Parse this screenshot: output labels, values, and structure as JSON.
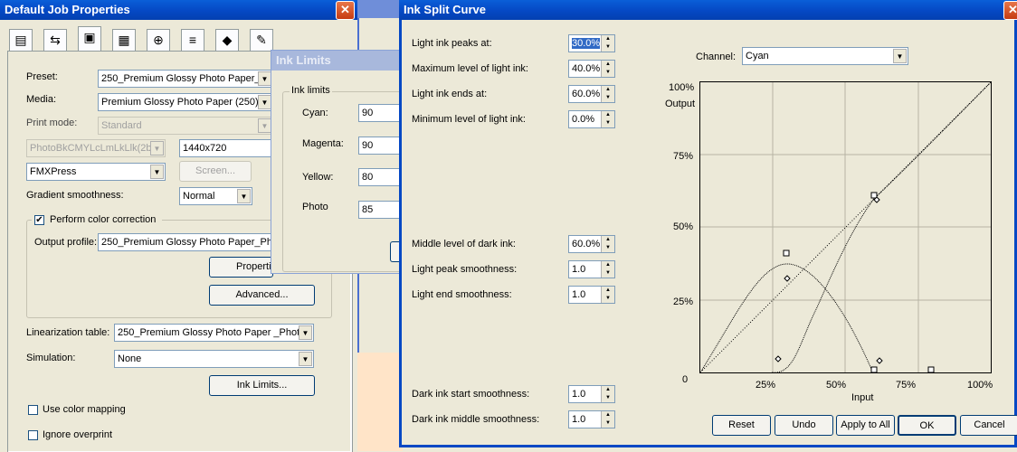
{
  "job_props": {
    "title": "Default Job Properties",
    "close": "✕",
    "tab_icons": [
      "printer-icon",
      "arrows-icon",
      "color-icon",
      "film-icon",
      "target-icon",
      "layers-icon",
      "stack-icon",
      "palette-icon"
    ],
    "preset_label": "Preset:",
    "preset_value": "250_Premium Glossy Photo Paper_P",
    "media_label": "Media:",
    "media_value": "Premium Glossy Photo Paper (250)",
    "print_mode_label": "Print mode:",
    "print_mode_value": "Standard",
    "ink_set_value": "PhotoBkCMYLcLmLkLlk(2b",
    "resolution_value": "1440x720",
    "screening_value": "FMXPress",
    "screen_button": "Screen...",
    "gradient_label": "Gradient smoothness:",
    "gradient_value": "Normal",
    "color_correction_label": "Perform color correction",
    "color_correction_checked": "✔",
    "output_profile_label": "Output profile:",
    "output_profile_value": "250_Premium Glossy Photo Paper_Phot",
    "properties_button": "Properties...",
    "advanced_button": "Advanced...",
    "linearization_label": "Linearization table:",
    "linearization_value": "250_Premium Glossy Photo Paper _PhotoE",
    "simulation_label": "Simulation:",
    "simulation_value": "None",
    "ink_limits_button": "Ink Limits...",
    "color_mapping_label": "Use color mapping",
    "ignore_overprint_label": "Ignore overprint"
  },
  "ink_limits": {
    "title": "Ink Limits",
    "group_label": "Ink limits",
    "rows": [
      {
        "label": "Cyan:",
        "value": "90"
      },
      {
        "label": "Magenta:",
        "value": "90"
      },
      {
        "label": "Yellow:",
        "value": "80"
      },
      {
        "label": "Photo",
        "value": "85"
      }
    ]
  },
  "curve": {
    "title": "Ink Split Curve",
    "close": "✕",
    "params_top": [
      {
        "label": "Light ink peaks at:",
        "value": "30.0%"
      },
      {
        "label": "Maximum level of light ink:",
        "value": "40.0%"
      },
      {
        "label": "Light ink ends at:",
        "value": "60.0%"
      },
      {
        "label": "Minimum level of light ink:",
        "value": "0.0%"
      }
    ],
    "params_mid": [
      {
        "label": "Middle level of dark ink:",
        "value": "60.0%"
      },
      {
        "label": "Light peak smoothness:",
        "value": "1.0"
      },
      {
        "label": "Light end smoothness:",
        "value": "1.0"
      }
    ],
    "params_bottom": [
      {
        "label": "Dark ink start smoothness:",
        "value": "1.0"
      },
      {
        "label": "Dark ink middle smoothness:",
        "value": "1.0"
      }
    ],
    "channel_label": "Channel:",
    "channel_value": "Cyan",
    "y_ticks": [
      "100%",
      "75%",
      "50%",
      "25%",
      "0"
    ],
    "y_title": "Output",
    "x_ticks": [
      "25%",
      "50%",
      "75%",
      "100%"
    ],
    "x_title": "Input",
    "buttons": {
      "reset": "Reset",
      "undo": "Undo",
      "apply_all": "Apply to All",
      "ok": "OK",
      "cancel": "Cancel"
    }
  },
  "colors": {
    "title_bar": "#0548c4",
    "dialog_bg": "#ece9d8",
    "selection": "#316ac5"
  }
}
